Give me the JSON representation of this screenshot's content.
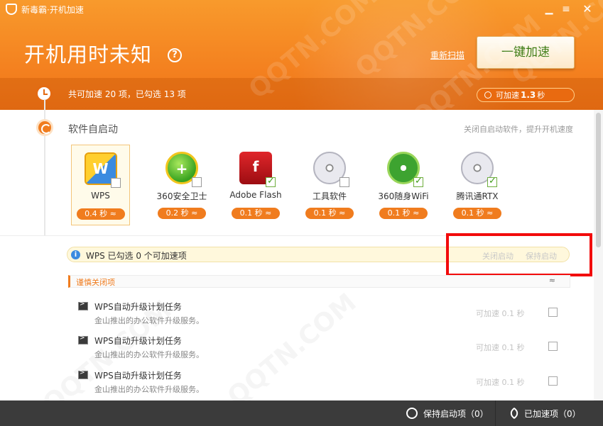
{
  "window": {
    "title": "新毒霸·开机加速",
    "minimize": "▁",
    "menu": "≡",
    "close": "✕"
  },
  "header": {
    "boot_title": "开机用时未知",
    "help": "?",
    "rescan_label": "重新扫描",
    "one_click_label": "一键加速",
    "summary": "共可加速 20 项，已勾选 13 项",
    "speed_prefix": "可加速",
    "speed_value": "1.3",
    "speed_unit": "秒"
  },
  "section": {
    "title": "软件自启动",
    "hint": "关闭自启动软件，提升开机速度"
  },
  "apps": [
    {
      "name": "WPS",
      "time": "0.4 秒 ≈",
      "checked": false,
      "icon": "wps-icon"
    },
    {
      "name": "360安全卫士",
      "time": "0.2 秒 ≈",
      "checked": false,
      "icon": "security-360-icon"
    },
    {
      "name": "Adobe Flash",
      "time": "0.1 秒 ≈",
      "checked": true,
      "icon": "flash-icon"
    },
    {
      "name": "工具软件",
      "time": "0.1 秒 ≈",
      "checked": false,
      "icon": "disc-icon"
    },
    {
      "name": "360随身WiFi",
      "time": "0.1 秒 ≈",
      "checked": true,
      "icon": "wifi-icon"
    },
    {
      "name": "腾讯通RTX",
      "time": "0.1 秒 ≈",
      "checked": true,
      "icon": "disc-icon"
    }
  ],
  "info": {
    "icon": "i",
    "text": "WPS 已勾选 0 个可加速项",
    "disable": "关闭启动",
    "keep": "保持启动"
  },
  "group": {
    "title": "谨慎关闭项",
    "collapse": "≈"
  },
  "tasks": [
    {
      "name": "WPS自动升级计划任务",
      "desc": "金山推出的办公软件升级服务。",
      "speed": "可加速 0.1 秒"
    },
    {
      "name": "WPS自动升级计划任务",
      "desc": "金山推出的办公软件升级服务。",
      "speed": "可加速 0.1 秒"
    },
    {
      "name": "WPS自动升级计划任务",
      "desc": "金山推出的办公软件升级服务。",
      "speed": "可加速 0.1 秒"
    }
  ],
  "footer": {
    "kept_label": "保持启动项（0）",
    "accel_label": "已加速项（0）"
  },
  "watermark": "QQTN.COM",
  "colors": {
    "accent": "#f07c1e",
    "highlight": "#f20b0b",
    "footer_bg": "#3b3b3b"
  }
}
